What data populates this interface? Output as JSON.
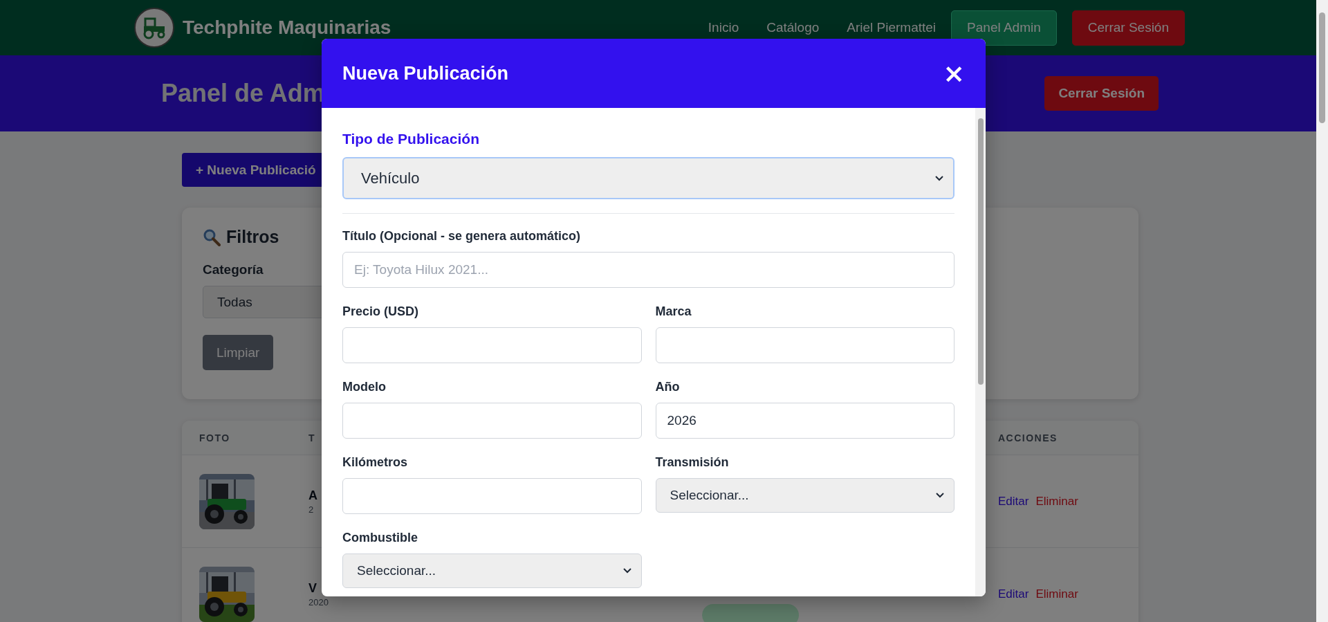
{
  "navbar": {
    "brand": "Techphite Maquinarias",
    "links": [
      {
        "label": "Inicio"
      },
      {
        "label": "Catálogo"
      },
      {
        "label": "Ariel Piermattei"
      }
    ],
    "buttons": [
      {
        "label": "Panel Admin",
        "kind": "admin"
      },
      {
        "label": "Cerrar Sesión",
        "kind": "logout"
      }
    ]
  },
  "header": {
    "title": "Panel de Adm",
    "button": "Cerrar Sesión"
  },
  "new_button": "+ Nueva Publicació",
  "filters": {
    "title": "Filtros",
    "category_label": "Categoría",
    "category_value": "Todas",
    "clear_button": "Limpiar"
  },
  "table": {
    "columns": [
      "FOTO",
      "T",
      "ACCIONES"
    ],
    "rows": [
      {
        "photo": {
          "kind": "picture"
        },
        "title": "A",
        "subtitle": "2",
        "actions": [
          "Editar",
          "Eliminar"
        ]
      },
      {
        "photo": {
          "kind": "picture"
        },
        "title": "V",
        "subtitle": "2020",
        "status": {
          "kind": "badge"
        },
        "actions": [
          "Editar",
          "Eliminar"
        ]
      }
    ]
  },
  "modal": {
    "title": "Nueva Publicación",
    "close": "×",
    "type_label": "Tipo de Publicación",
    "type_value": "Vehículo",
    "fields": [
      {
        "label": "Título (Opcional - se genera automático)",
        "kind": "input",
        "placeholder": "Ej: Toyota Hilux 2021...",
        "wide": true
      },
      {
        "label": "Precio (USD)",
        "kind": "input",
        "wide": false
      },
      {
        "label": "Marca",
        "kind": "input",
        "wide": false
      },
      {
        "label": "Modelo",
        "kind": "input",
        "wide": false
      },
      {
        "label": "Año",
        "kind": "input",
        "value": "2026",
        "wide": false
      },
      {
        "label": "Kilómetros",
        "kind": "input",
        "wide": false
      },
      {
        "label": "Transmisión",
        "kind": "select",
        "value": "Seleccionar...",
        "wide": false
      },
      {
        "label": "Combustible",
        "kind": "select",
        "value": "Seleccionar...",
        "wide": false
      }
    ]
  }
}
